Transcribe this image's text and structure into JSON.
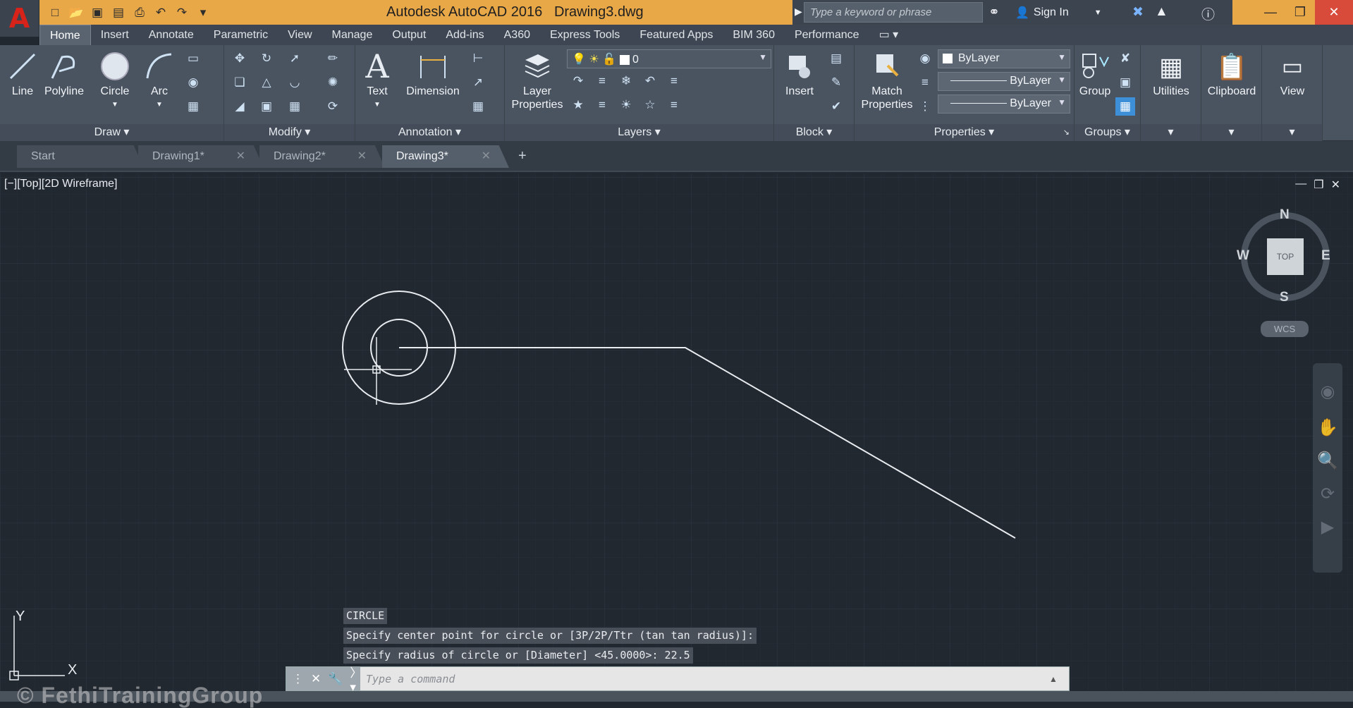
{
  "app": {
    "logo": "A",
    "title": "Autodesk AutoCAD 2016",
    "filename": "Drawing3.dwg"
  },
  "search": {
    "placeholder": "Type a keyword or phrase"
  },
  "account": {
    "signin": "Sign In"
  },
  "ribbon_tabs": [
    "Home",
    "Insert",
    "Annotate",
    "Parametric",
    "View",
    "Manage",
    "Output",
    "Add-ins",
    "A360",
    "Express Tools",
    "Featured Apps",
    "BIM 360",
    "Performance"
  ],
  "draw": {
    "panel": "Draw",
    "line": "Line",
    "polyline": "Polyline",
    "circle": "Circle",
    "arc": "Arc"
  },
  "modify": {
    "panel": "Modify"
  },
  "annotation": {
    "panel": "Annotation",
    "text": "Text",
    "dimension": "Dimension"
  },
  "layers": {
    "panel": "Layers",
    "layer_properties_1": "Layer",
    "layer_properties_2": "Properties",
    "current_layer": "0"
  },
  "block": {
    "panel": "Block",
    "insert": "Insert"
  },
  "properties": {
    "panel": "Properties",
    "match_1": "Match",
    "match_2": "Properties",
    "color": "ByLayer",
    "linetype": "ByLayer",
    "lineweight": "ByLayer"
  },
  "groups": {
    "panel": "Groups",
    "group": "Group"
  },
  "utilities": {
    "label": "Utilities"
  },
  "clipboard": {
    "label": "Clipboard"
  },
  "view": {
    "label": "View"
  },
  "doc_tabs": {
    "start": "Start",
    "d1": "Drawing1*",
    "d2": "Drawing2*",
    "d3": "Drawing3*"
  },
  "viewport": {
    "label": "[−][Top][2D Wireframe]"
  },
  "viewcube": {
    "n": "N",
    "s": "S",
    "e": "E",
    "w": "W",
    "top": "TOP",
    "wcs": "WCS"
  },
  "ucs": {
    "x": "X",
    "y": "Y"
  },
  "command": {
    "history": [
      "CIRCLE",
      "Specify center point for circle or [3P/2P/Ttr (tan tan radius)]:",
      "Specify radius of circle or [Diameter] <45.0000>: 22.5"
    ],
    "placeholder": "Type a command"
  },
  "watermark": "© FethiTrainingGroup",
  "colors": {
    "accent": "#e8a848",
    "canvas": "#212830",
    "ribbon": "#4a5360"
  }
}
